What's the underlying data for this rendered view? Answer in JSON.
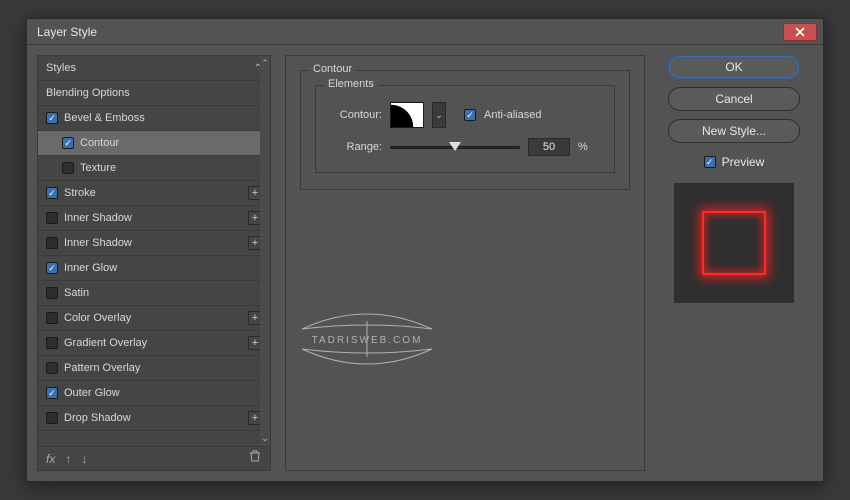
{
  "window": {
    "title": "Layer Style"
  },
  "sidebar": {
    "header": "Styles",
    "items": [
      {
        "label": "Blending Options",
        "checked": null,
        "indent": false,
        "plus": false
      },
      {
        "label": "Bevel & Emboss",
        "checked": true,
        "indent": false,
        "plus": false
      },
      {
        "label": "Contour",
        "checked": true,
        "indent": true,
        "plus": false,
        "selected": true
      },
      {
        "label": "Texture",
        "checked": false,
        "indent": true,
        "plus": false
      },
      {
        "label": "Stroke",
        "checked": true,
        "indent": false,
        "plus": true
      },
      {
        "label": "Inner Shadow",
        "checked": false,
        "indent": false,
        "plus": true
      },
      {
        "label": "Inner Shadow",
        "checked": false,
        "indent": false,
        "plus": true
      },
      {
        "label": "Inner Glow",
        "checked": true,
        "indent": false,
        "plus": false
      },
      {
        "label": "Satin",
        "checked": false,
        "indent": false,
        "plus": false
      },
      {
        "label": "Color Overlay",
        "checked": false,
        "indent": false,
        "plus": true
      },
      {
        "label": "Gradient Overlay",
        "checked": false,
        "indent": false,
        "plus": true
      },
      {
        "label": "Pattern Overlay",
        "checked": false,
        "indent": false,
        "plus": false
      },
      {
        "label": "Outer Glow",
        "checked": true,
        "indent": false,
        "plus": false
      },
      {
        "label": "Drop Shadow",
        "checked": false,
        "indent": false,
        "plus": true
      }
    ],
    "footer": {
      "fx": "fx"
    }
  },
  "panel": {
    "title": "Contour",
    "subfieldset": "Elements",
    "contour_label": "Contour:",
    "anti_aliased_label": "Anti-aliased",
    "anti_aliased_checked": true,
    "range_label": "Range:",
    "range_value": "50",
    "range_unit": "%",
    "range_percent": 50
  },
  "buttons": {
    "ok": "OK",
    "cancel": "Cancel",
    "new_style": "New Style..."
  },
  "preview": {
    "label": "Preview",
    "checked": true
  },
  "watermark": {
    "text": "TADRISWEB.COM"
  }
}
